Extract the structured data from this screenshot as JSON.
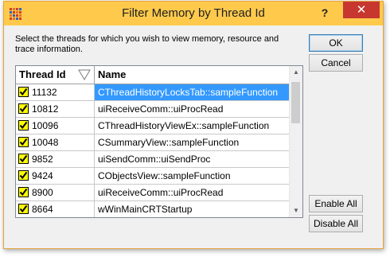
{
  "window": {
    "title": "Filter Memory by Thread Id",
    "help_label": "?",
    "close_label": "✕",
    "accent_color": "#ffca4c",
    "close_color": "#c7372f"
  },
  "instructions": "Select the threads for which you wish to view memory, resource and trace information.",
  "grid": {
    "columns": [
      "Thread Id",
      "Name"
    ],
    "sort_icon": "sort-descending-icon",
    "selected_row_color": "#3399ff",
    "rows": [
      {
        "checked": true,
        "id": "11132",
        "name": "CThreadHistoryLocksTab::sampleFunction",
        "selected": true
      },
      {
        "checked": true,
        "id": "10812",
        "name": "uiReceiveComm::uiProcRead",
        "selected": false
      },
      {
        "checked": true,
        "id": "10096",
        "name": "CThreadHistoryViewEx::sampleFunction",
        "selected": false
      },
      {
        "checked": true,
        "id": "10048",
        "name": "CSummaryView::sampleFunction",
        "selected": false
      },
      {
        "checked": true,
        "id": "9852",
        "name": "uiSendComm::uiSendProc",
        "selected": false
      },
      {
        "checked": true,
        "id": "9424",
        "name": "CObjectsView::sampleFunction",
        "selected": false
      },
      {
        "checked": true,
        "id": "8900",
        "name": "uiReceiveComm::uiProcRead",
        "selected": false
      },
      {
        "checked": true,
        "id": "8664",
        "name": "wWinMainCRTStartup",
        "selected": false
      }
    ]
  },
  "buttons": {
    "ok": "OK",
    "cancel": "Cancel",
    "enable_all": "Enable All",
    "disable_all": "Disable All"
  }
}
